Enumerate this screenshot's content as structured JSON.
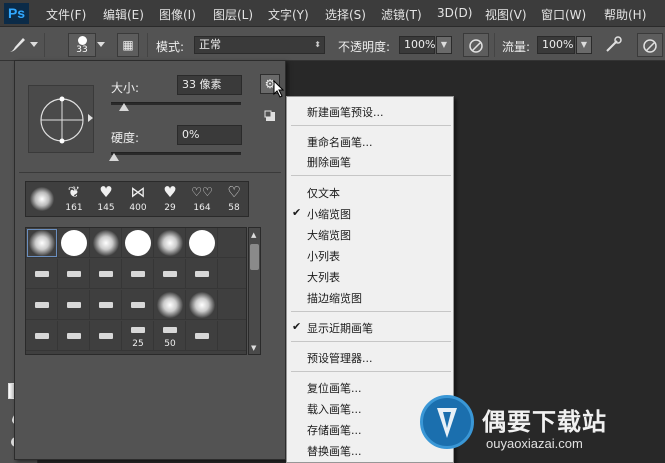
{
  "app": {
    "logo": "Ps"
  },
  "menubar": {
    "items": [
      "文件(F)",
      "编辑(E)",
      "图像(I)",
      "图层(L)",
      "文字(Y)",
      "选择(S)",
      "滤镜(T)",
      "3D(D)",
      "视图(V)",
      "窗口(W)",
      "帮助(H)"
    ]
  },
  "options": {
    "brush_size": "33",
    "mode_label": "模式:",
    "mode_value": "正常",
    "opacity_label": "不透明度:",
    "opacity_value": "100%",
    "flow_label": "流量:",
    "flow_value": "100%",
    "icons": [
      "brush-tool-icon",
      "brush-preset-picker-icon",
      "toggle-brush-panel-icon",
      "pressure-opacity-icon",
      "airbrush-icon",
      "pressure-size-icon"
    ]
  },
  "brush_panel": {
    "size_label": "大小:",
    "size_value": "33 像素",
    "hardness_label": "硬度:",
    "hardness_value": "0%",
    "size_level": 0.1,
    "hardness_level": 0.0,
    "recent": [
      {
        "icon": "soft-round-brush-icon",
        "num": ""
      },
      {
        "icon": "strawberry-brush-icon",
        "num": "161"
      },
      {
        "icon": "heart-brush-icon",
        "num": "145"
      },
      {
        "icon": "bow-brush-icon",
        "num": "400"
      },
      {
        "icon": "heart-brush-icon",
        "num": "29"
      },
      {
        "icon": "hearts-brush-icon",
        "num": "164"
      },
      {
        "icon": "heart-outline-brush-icon",
        "num": "58"
      }
    ],
    "grid_numbers": [
      "25",
      "50"
    ]
  },
  "context_menu": {
    "items": [
      "新建画笔预设...",
      "重命名画笔...",
      "删除画笔",
      "仅文本",
      "小缩览图",
      "大缩览图",
      "小列表",
      "大列表",
      "描边缩览图",
      "显示近期画笔",
      "预设管理器...",
      "复位画笔...",
      "载入画笔...",
      "存储画笔...",
      "替换画笔..."
    ],
    "checked": [
      "小缩览图",
      "显示近期画笔"
    ]
  },
  "watermark": {
    "title": "偶要下载站",
    "url": "ouyaoxiazai.com"
  }
}
